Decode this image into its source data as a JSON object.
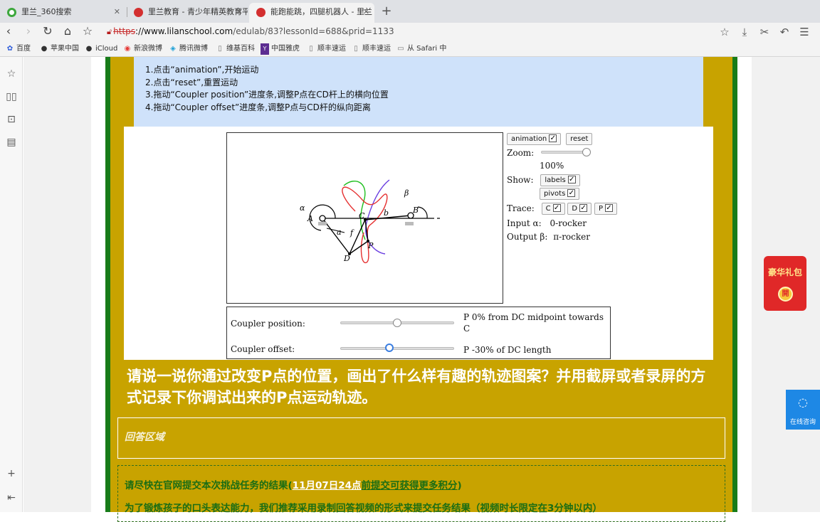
{
  "tabs": [
    {
      "title": "里兰_360搜索",
      "active": false
    },
    {
      "title": "里兰教育 - 青少年精英教育平",
      "active": false
    },
    {
      "title": "能跑能跳，四腿机器人 - 里兰",
      "active": true
    }
  ],
  "address": {
    "protocol": "https",
    "host": "://www.lilanschool.com",
    "path": "/edulab/83?lessonId=688&prid=1133"
  },
  "bookmarks": [
    "百度",
    "苹果中国",
    "iCloud",
    "新浪微博",
    "腾讯微博",
    "维基百科",
    "中国雅虎",
    "顺丰速运",
    "顺丰速运",
    "从 Safari 中"
  ],
  "instructions": [
    "1.点击“animation”,开始运动",
    "2.点击“reset”,重置运动",
    "3.拖动“Coupler position”进度条,调整P点在CD杆上的横向位置",
    "4.拖动“Coupler offset”进度条,调整P点与CD杆的纵向距离"
  ],
  "diagram_labels": {
    "alpha": "α",
    "beta": "β",
    "A": "A",
    "B": "B",
    "C": "C",
    "D": "D",
    "P": "P",
    "a": "a",
    "b": "b",
    "f": "f"
  },
  "controls": {
    "animation": "animation",
    "reset": "reset",
    "zoom_label": "Zoom:",
    "zoom_value": "100%",
    "show_label": "Show:",
    "labels": "labels",
    "pivots": "pivots",
    "trace_label": "Trace:",
    "trace_c": "C",
    "trace_d": "D",
    "trace_p": "P",
    "input_label": "Input α:",
    "input_value": "0-rocker",
    "output_label": "Output β:",
    "output_value": "π-rocker",
    "zoom_level": 1.0
  },
  "coupler": {
    "position_label": "Coupler position:",
    "position_value": "P 0% from DC midpoint towards C",
    "position_fraction": 0.5,
    "offset_label": "Coupler offset:",
    "offset_value": "P -30% of DC length",
    "offset_fraction": 0.43
  },
  "question": "请说一说你通过改变P点的位置，画出了什么样有趣的轨迹图案？并用截屏或者录屏的方式记录下你调试出来的P点运动轨迹。",
  "answer_label": "回答区域",
  "notice": {
    "prefix": "请尽快在官网提交本次挑战任务的结果(",
    "date": "11月07日24点",
    "link": "前提交可获得更多积分",
    "suffix": ")",
    "line2": "为了锻炼孩子的口头表达能力，我们推荐采用录制回答视频的形式来提交任务结果（视频时长限定在3分钟以内）"
  },
  "widgets": {
    "redpack_title": "豪华礼包",
    "redpack_coin": "開",
    "consult": "在线咨询"
  }
}
